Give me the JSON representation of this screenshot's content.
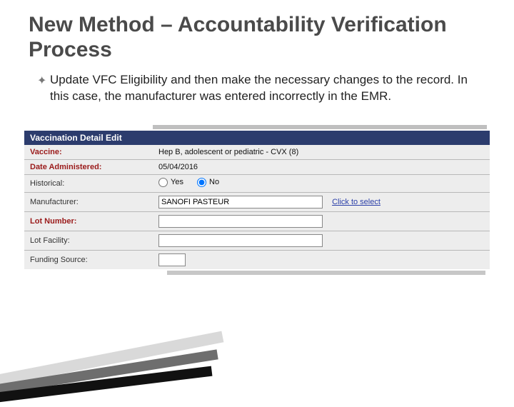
{
  "title": "New Method – Accountability Verification Process",
  "bullet": "Update VFC Eligibility and then make the necessary changes to the record.  In this case, the manufacturer was entered incorrectly in the EMR.",
  "form": {
    "header": "Vaccination Detail Edit",
    "vaccine_label": "Vaccine:",
    "vaccine_value": "Hep B, adolescent or pediatric - CVX (8)",
    "date_label": "Date Administered:",
    "date_value": "05/04/2016",
    "historical_label": "Historical:",
    "historical_yes": "Yes",
    "historical_no": "No",
    "historical_selected": "No",
    "manufacturer_label": "Manufacturer:",
    "manufacturer_value": "SANOFI PASTEUR",
    "manufacturer_link": "Click to select",
    "lot_label": "Lot Number:",
    "lot_value": "",
    "facility_label": "Lot Facility:",
    "facility_value": "",
    "funding_label": "Funding Source:",
    "funding_value": ""
  }
}
